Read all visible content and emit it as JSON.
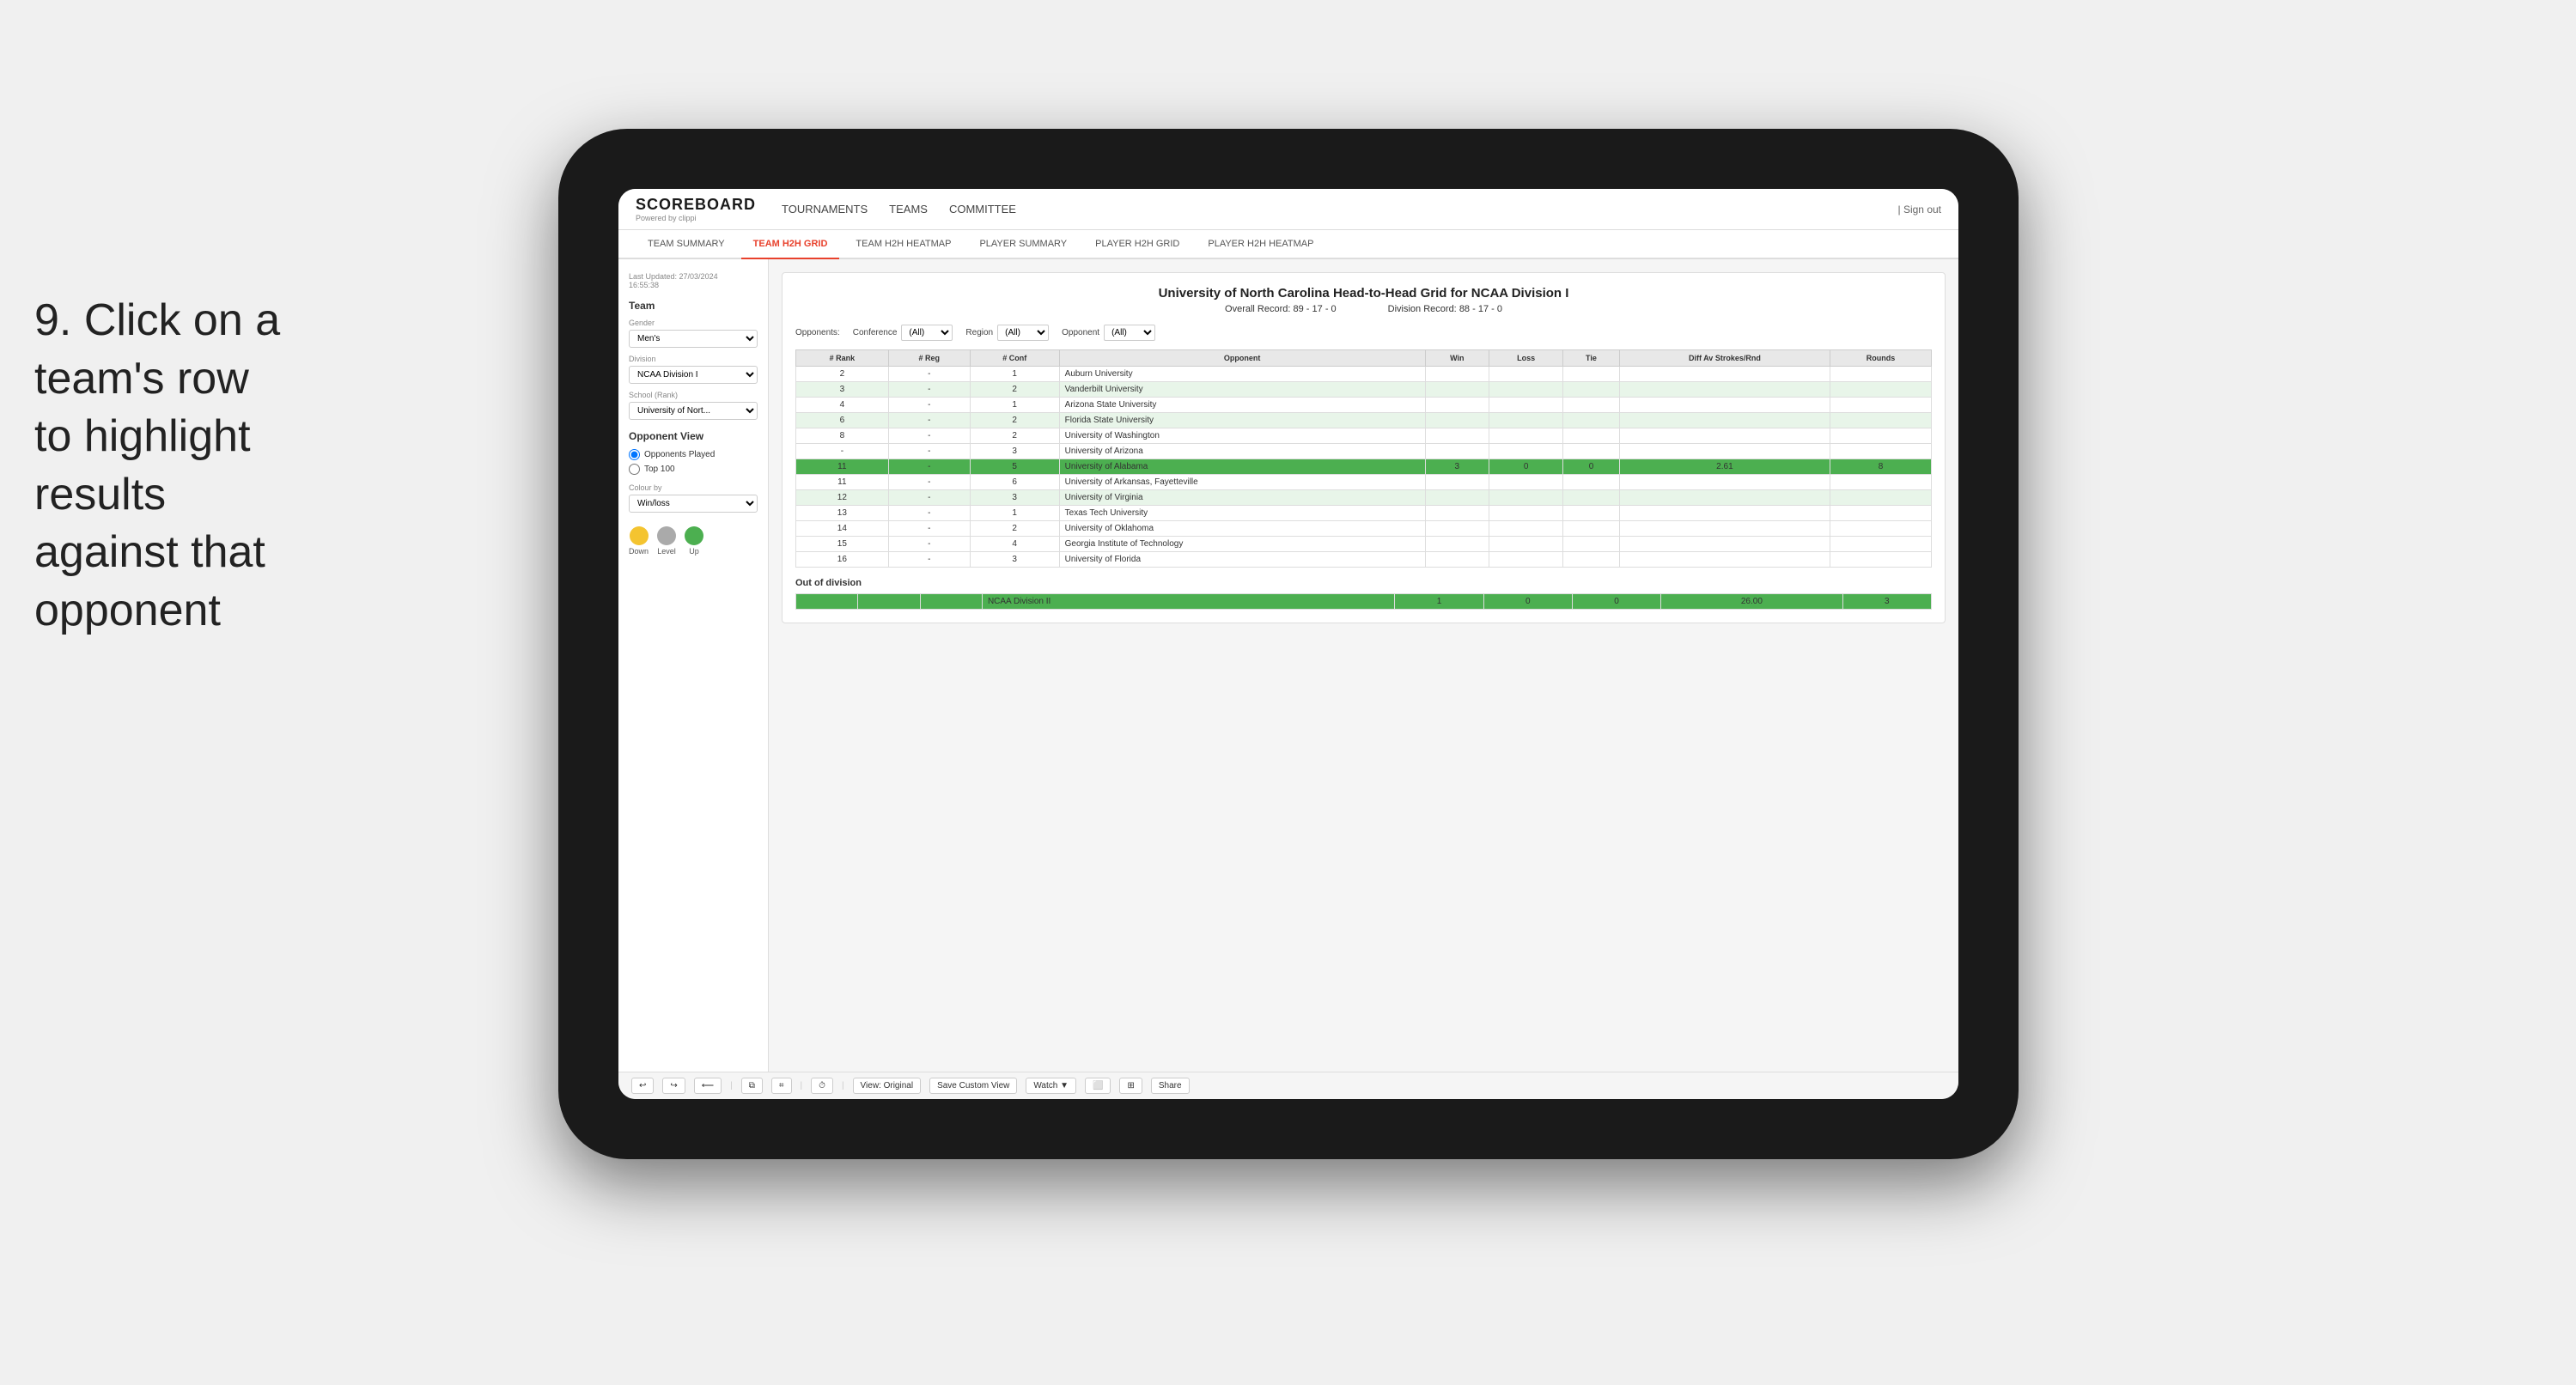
{
  "instruction": {
    "text": "9. Click on a team's row to highlight results against that opponent"
  },
  "nav": {
    "logo": "SCOREBOARD",
    "powered_by": "Powered by clippi",
    "links": [
      "TOURNAMENTS",
      "TEAMS",
      "COMMITTEE"
    ],
    "sign_in": "| Sign out"
  },
  "sub_nav": {
    "tabs": [
      "TEAM SUMMARY",
      "TEAM H2H GRID",
      "TEAM H2H HEATMAP",
      "PLAYER SUMMARY",
      "PLAYER H2H GRID",
      "PLAYER H2H HEATMAP"
    ],
    "active": "TEAM H2H GRID"
  },
  "sidebar": {
    "last_updated_label": "Last Updated: 27/03/2024",
    "time": "16:55:38",
    "team_label": "Team",
    "gender_label": "Gender",
    "gender_value": "Men's",
    "division_label": "Division",
    "division_value": "NCAA Division I",
    "school_label": "School (Rank)",
    "school_value": "University of Nort...",
    "opponent_view_label": "Opponent View",
    "opponent_options": [
      "Opponents Played",
      "Top 100"
    ],
    "opponent_selected": "Opponents Played",
    "colour_by_label": "Colour by",
    "colour_by_value": "Win/loss",
    "legend": {
      "down_label": "Down",
      "level_label": "Level",
      "up_label": "Up",
      "down_color": "#f4c430",
      "level_color": "#aaaaaa",
      "up_color": "#4caf50"
    }
  },
  "grid": {
    "title": "University of North Carolina Head-to-Head Grid for NCAA Division I",
    "overall_record_label": "Overall Record:",
    "overall_record": "89 - 17 - 0",
    "division_record_label": "Division Record:",
    "division_record": "88 - 17 - 0",
    "filters": {
      "conference_label": "Conference",
      "conference_value": "(All)",
      "region_label": "Region",
      "region_value": "(All)",
      "opponent_label": "Opponent",
      "opponent_value": "(All)"
    },
    "table_headers": [
      "# Rank",
      "# Reg",
      "# Conf",
      "Opponent",
      "Win",
      "Loss",
      "Tie",
      "Diff Av Strokes/Rnd",
      "Rounds"
    ],
    "rows": [
      {
        "rank": "2",
        "reg": "-",
        "conf": "1",
        "opponent": "Auburn University",
        "win": "",
        "loss": "",
        "tie": "",
        "diff": "",
        "rounds": "",
        "style": "normal"
      },
      {
        "rank": "3",
        "reg": "-",
        "conf": "2",
        "opponent": "Vanderbilt University",
        "win": "",
        "loss": "",
        "tie": "",
        "diff": "",
        "rounds": "",
        "style": "light-green"
      },
      {
        "rank": "4",
        "reg": "-",
        "conf": "1",
        "opponent": "Arizona State University",
        "win": "",
        "loss": "",
        "tie": "",
        "diff": "",
        "rounds": "",
        "style": "normal"
      },
      {
        "rank": "6",
        "reg": "-",
        "conf": "2",
        "opponent": "Florida State University",
        "win": "",
        "loss": "",
        "tie": "",
        "diff": "",
        "rounds": "",
        "style": "light-green"
      },
      {
        "rank": "8",
        "reg": "-",
        "conf": "2",
        "opponent": "University of Washington",
        "win": "",
        "loss": "",
        "tie": "",
        "diff": "",
        "rounds": "",
        "style": "normal"
      },
      {
        "rank": "-",
        "reg": "-",
        "conf": "3",
        "opponent": "University of Arizona",
        "win": "",
        "loss": "",
        "tie": "",
        "diff": "",
        "rounds": "",
        "style": "normal"
      },
      {
        "rank": "11",
        "reg": "-",
        "conf": "5",
        "opponent": "University of Alabama",
        "win": "3",
        "loss": "0",
        "tie": "0",
        "diff": "2.61",
        "rounds": "8",
        "style": "highlighted"
      },
      {
        "rank": "11",
        "reg": "-",
        "conf": "6",
        "opponent": "University of Arkansas, Fayetteville",
        "win": "",
        "loss": "",
        "tie": "",
        "diff": "",
        "rounds": "",
        "style": "normal"
      },
      {
        "rank": "12",
        "reg": "-",
        "conf": "3",
        "opponent": "University of Virginia",
        "win": "",
        "loss": "",
        "tie": "",
        "diff": "",
        "rounds": "",
        "style": "light-green"
      },
      {
        "rank": "13",
        "reg": "-",
        "conf": "1",
        "opponent": "Texas Tech University",
        "win": "",
        "loss": "",
        "tie": "",
        "diff": "",
        "rounds": "",
        "style": "normal"
      },
      {
        "rank": "14",
        "reg": "-",
        "conf": "2",
        "opponent": "University of Oklahoma",
        "win": "",
        "loss": "",
        "tie": "",
        "diff": "",
        "rounds": "",
        "style": "normal"
      },
      {
        "rank": "15",
        "reg": "-",
        "conf": "4",
        "opponent": "Georgia Institute of Technology",
        "win": "",
        "loss": "",
        "tie": "",
        "diff": "",
        "rounds": "",
        "style": "normal"
      },
      {
        "rank": "16",
        "reg": "-",
        "conf": "3",
        "opponent": "University of Florida",
        "win": "",
        "loss": "",
        "tie": "",
        "diff": "",
        "rounds": "",
        "style": "normal"
      }
    ],
    "out_of_division_label": "Out of division",
    "out_of_division_row": {
      "label": "NCAA Division II",
      "win": "1",
      "loss": "0",
      "tie": "0",
      "diff": "26.00",
      "rounds": "3",
      "style": "highlighted"
    }
  },
  "toolbar": {
    "buttons": [
      "View: Original",
      "Save Custom View",
      "Watch ▼",
      "Share"
    ]
  },
  "colors": {
    "active_tab": "#e8412c",
    "highlighted_row": "#4caf50",
    "light_green_row": "#e8f5e9",
    "yellow_row": "#fff9c4",
    "normal_row": "#ffffff"
  }
}
